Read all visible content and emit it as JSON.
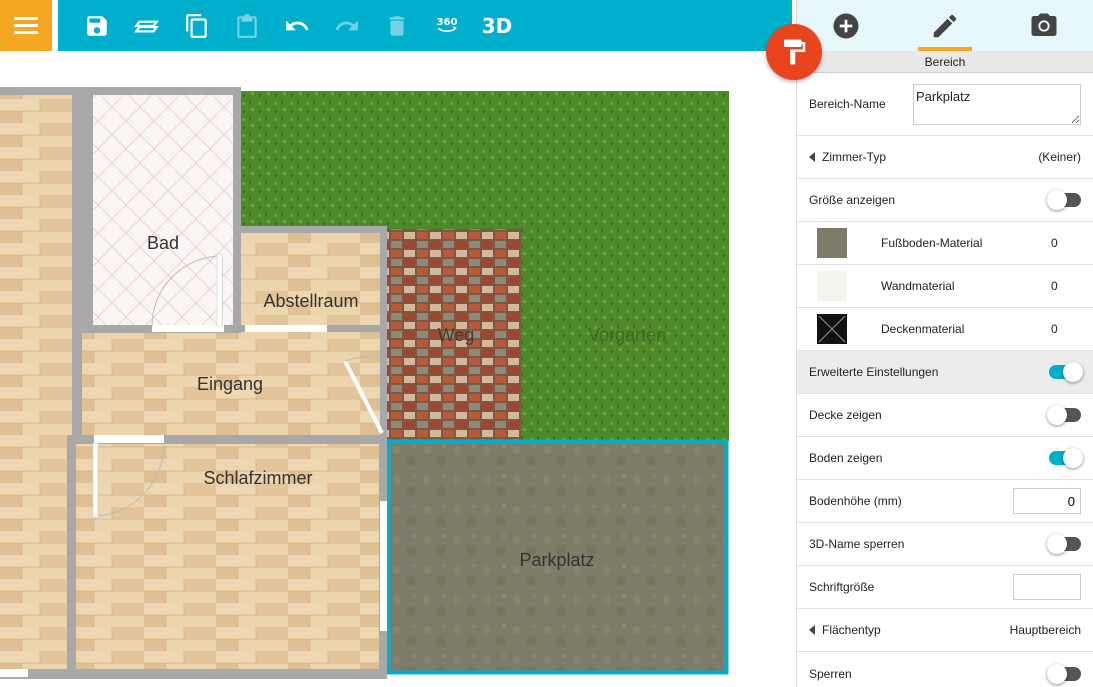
{
  "toolbar": {
    "items": [
      "menu",
      "save",
      "layers",
      "copy",
      "paste",
      "undo",
      "redo",
      "delete",
      "view-360",
      "view-3d"
    ],
    "label_360": "360",
    "label_3d": "3D"
  },
  "floorplan": {
    "rooms": {
      "bad": "Bad",
      "abstellraum": "Abstellraum",
      "eingang": "Eingang",
      "schlafzimmer": "Schlafzimmer",
      "weg": "Weg",
      "vorgarten": "Vorgarten",
      "parkplatz": "Parkplatz"
    }
  },
  "panel": {
    "header": "Bereich",
    "area_name_label": "Bereich-Name",
    "area_name_value": "Parkplatz",
    "room_type_label": "Zimmer-Typ",
    "room_type_value": "(Keiner)",
    "show_size_label": "Größe anzeigen",
    "floor_material_label": "Fußboden-Material",
    "floor_material_value": "0",
    "wall_material_label": "Wandmaterial",
    "wall_material_value": "0",
    "ceiling_material_label": "Deckenmaterial",
    "ceiling_material_value": "0",
    "advanced_label": "Erweiterte Einstellungen",
    "show_ceiling_label": "Decke zeigen",
    "show_floor_label": "Boden zeigen",
    "floor_height_label": "Bodenhöhe (mm)",
    "floor_height_value": "0",
    "lock_3d_name_label": "3D-Name sperren",
    "font_size_label": "Schriftgröße",
    "font_size_value": "",
    "surface_type_label": "Flächentyp",
    "surface_type_value": "Hauptbereich",
    "lock_label": "Sperren"
  },
  "colors": {
    "toolbar": "#00afcb",
    "menu": "#f5a623",
    "fab": "#e8441d",
    "selection": "#00afcb"
  }
}
